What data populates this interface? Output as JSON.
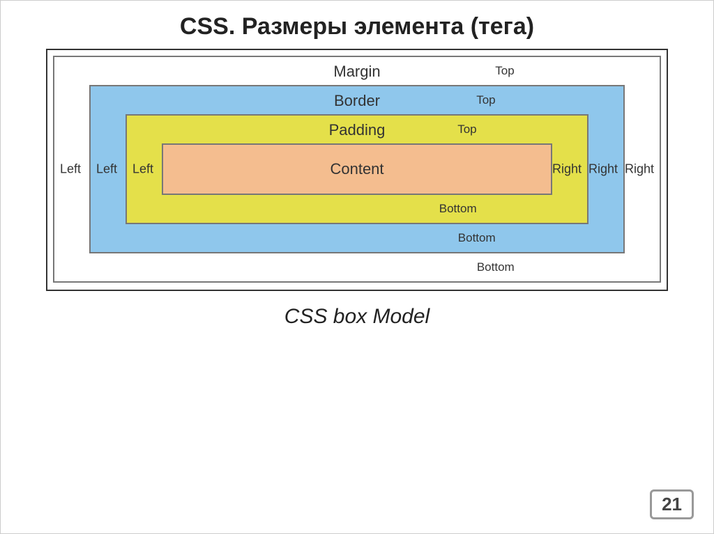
{
  "title": "CSS. Размеры элемента (тега)",
  "caption": "CSS box Model",
  "page_number": "21",
  "boxes": {
    "margin": {
      "name": "Margin",
      "top": "Top",
      "bottom": "Bottom",
      "left": "Left",
      "right": "Right"
    },
    "border": {
      "name": "Border",
      "top": "Top",
      "bottom": "Bottom",
      "left": "Left",
      "right": "Right"
    },
    "padding": {
      "name": "Padding",
      "top": "Top",
      "bottom": "Bottom",
      "left": "Left",
      "right": "Right"
    },
    "content": {
      "name": "Content"
    }
  }
}
